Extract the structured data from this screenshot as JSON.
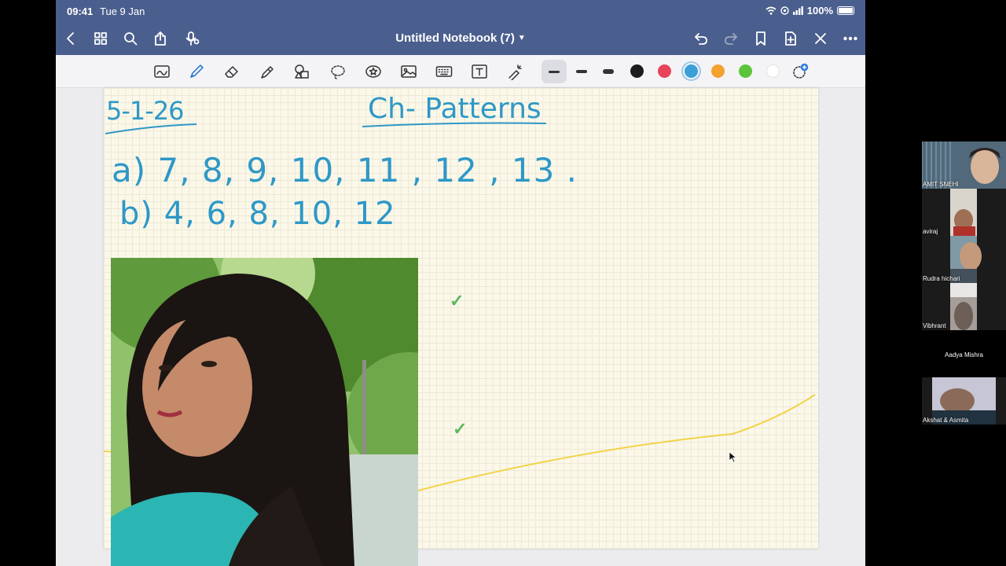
{
  "status_bar": {
    "time": "09:41",
    "date": "Tue 9 Jan",
    "battery": "100%"
  },
  "nav": {
    "title": "Untitled Notebook (7)",
    "icons": [
      "back-icon",
      "grid-icon",
      "search-icon",
      "share-icon",
      "mic-icon",
      "undo-icon",
      "redo-icon",
      "bookmark-icon",
      "add-page-icon",
      "close-icon",
      "more-icon"
    ]
  },
  "toolbar": {
    "tools": [
      "zoom-window-icon",
      "pen-icon",
      "eraser-icon",
      "highlighter-icon",
      "shapes-icon",
      "lasso-icon",
      "sticker-icon",
      "image-icon",
      "keyboard-icon",
      "text-icon",
      "laser-pointer-icon"
    ],
    "selected_tool": "pen",
    "colors": [
      "#1c1c1e",
      "#e8435a",
      "#3b9fd8",
      "#f4a12e",
      "#5cc43a",
      "#ffffff"
    ],
    "selected_color": "#3b9fd8"
  },
  "page": {
    "date": "5-1-26",
    "title": "Ch- Patterns",
    "line_a": "a) 7, 8, 9, 10, 11 , 12 , 13 .",
    "line_b": "b) 4, 6, 8, 10, 12",
    "ink_color": "#2e98c7",
    "check_color": "#5cb85c"
  },
  "participants": [
    {
      "name": "AMIT SNEHI"
    },
    {
      "name": "aviraj"
    },
    {
      "name": "Rudra hichari"
    },
    {
      "name": "Vibhrant"
    },
    {
      "name": "Aadya Mishra"
    },
    {
      "name": "Akshat & Asmita"
    }
  ]
}
